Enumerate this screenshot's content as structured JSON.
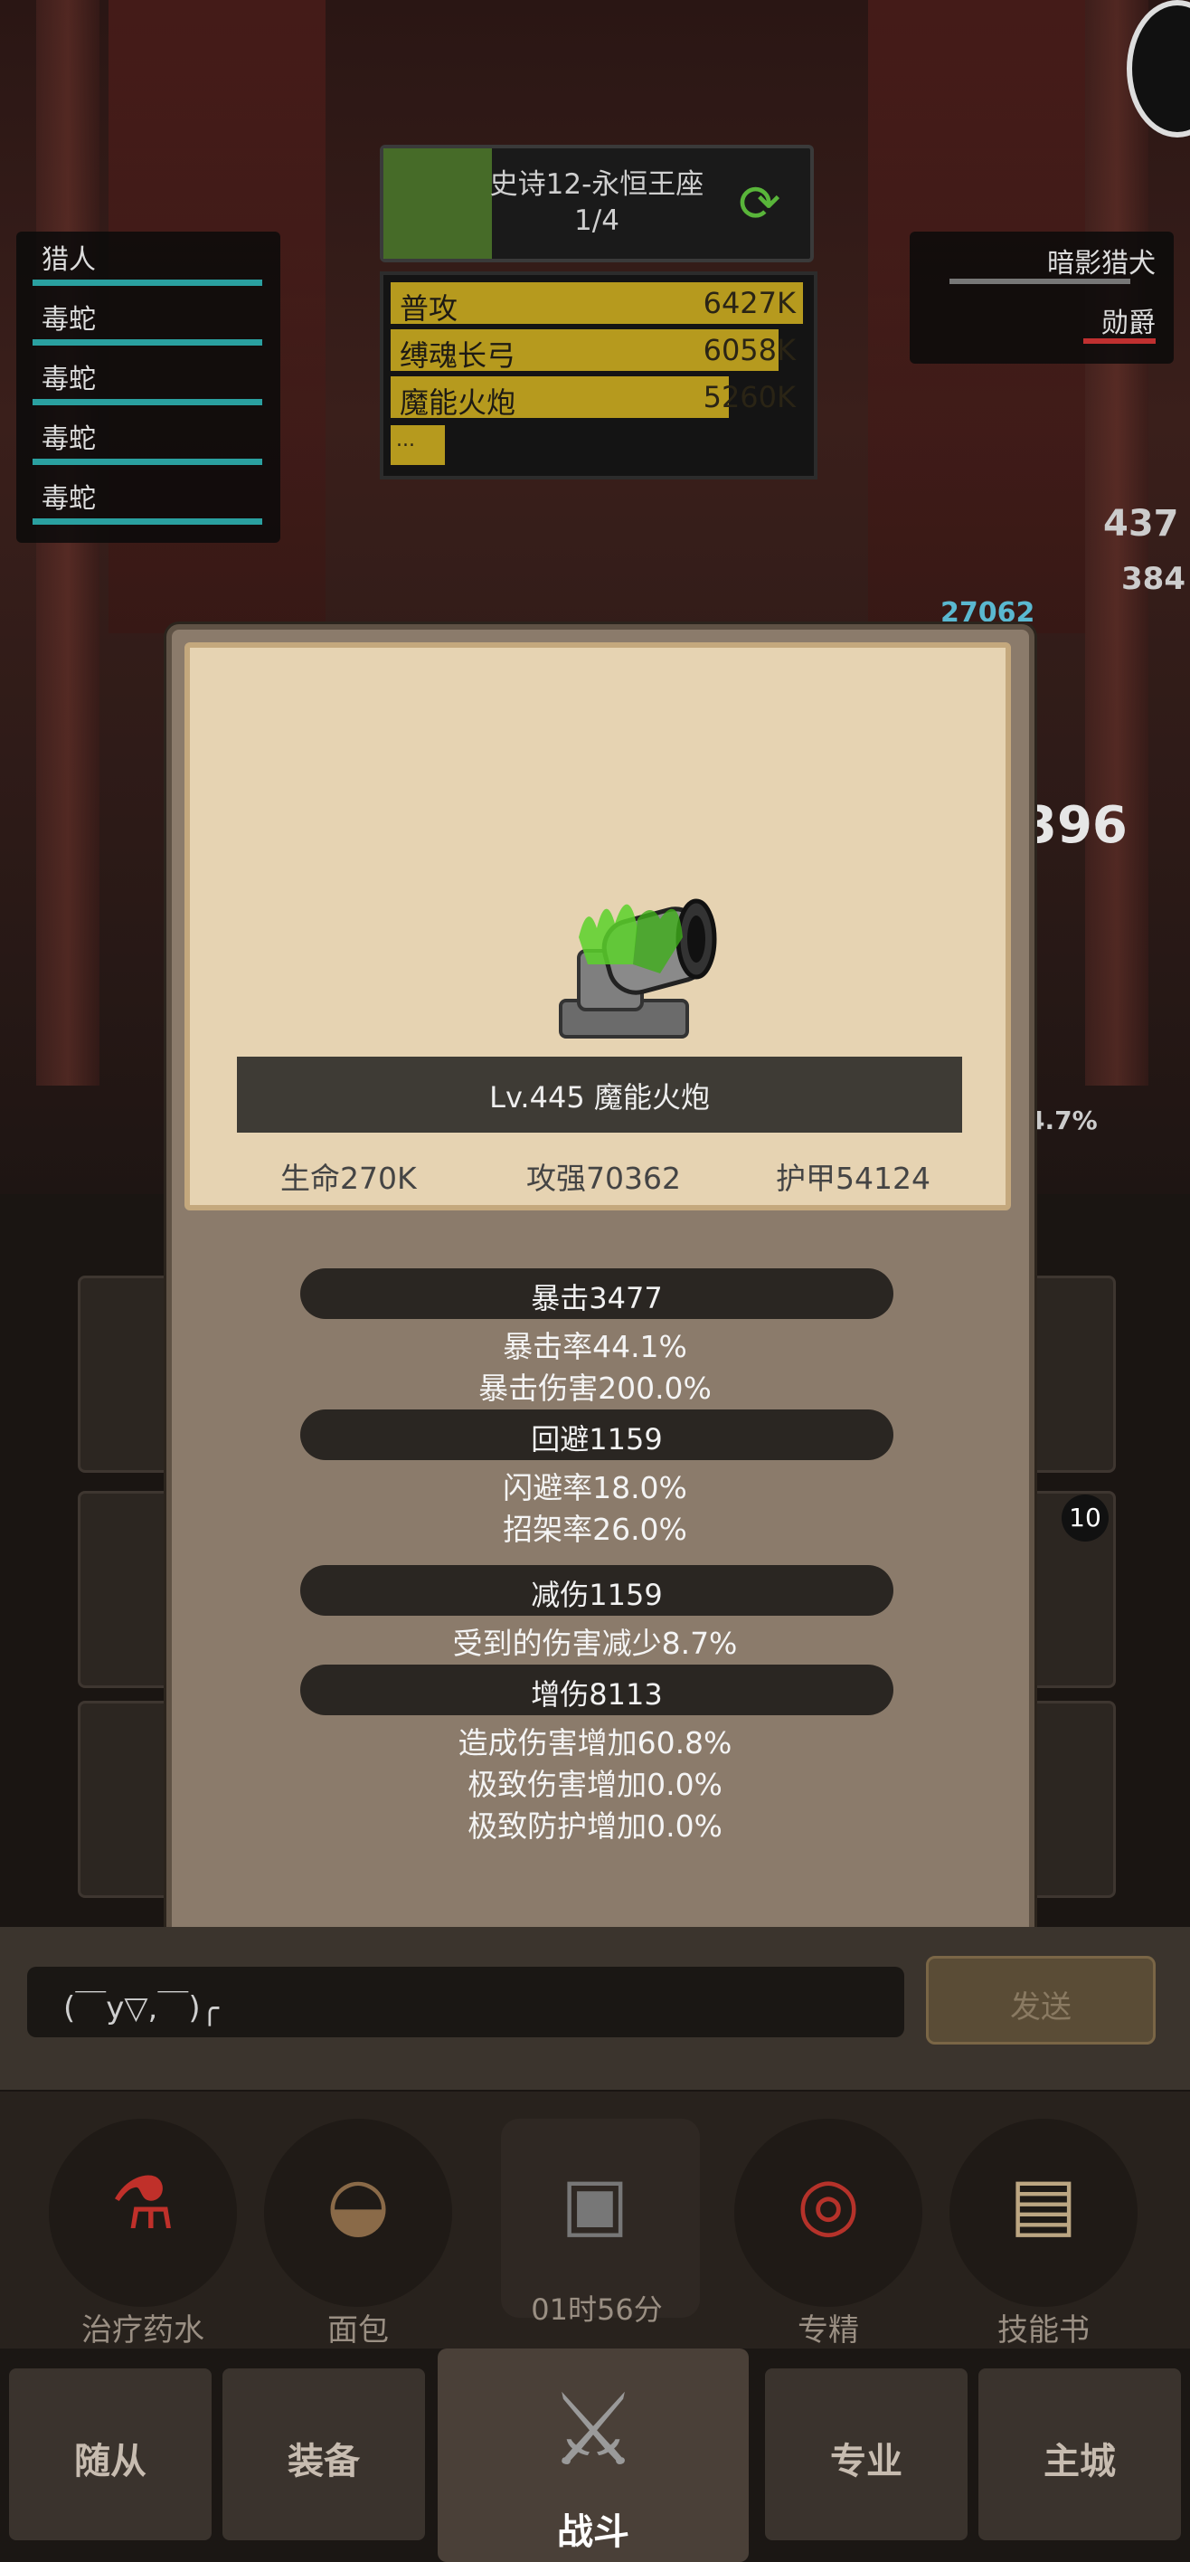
{
  "boss": {
    "name": "史诗12-永恒王座",
    "progress": "1/4"
  },
  "damage_list": [
    {
      "name": "普攻",
      "value": "6427K",
      "fraction": 1.0
    },
    {
      "name": "缚魂长弓",
      "value": "6058K",
      "fraction": 0.94
    },
    {
      "name": "魔能火炮",
      "value": "5260K",
      "fraction": 0.82
    }
  ],
  "damage_more": "...",
  "team_left": [
    "猎人",
    "毒蛇",
    "毒蛇",
    "毒蛇",
    "毒蛇"
  ],
  "team_right": [
    "暗影猎犬",
    "勋爵"
  ],
  "item": {
    "title": "Lv.445 魔能火炮",
    "hp": "生命270K",
    "atk": "攻强70362",
    "armor": "护甲54124"
  },
  "stats": [
    {
      "header": "暴击3477",
      "lines": [
        "暴击率44.1%",
        "暴击伤害200.0%"
      ]
    },
    {
      "header": "回避1159",
      "lines": [
        "闪避率18.0%",
        "招架率26.0%"
      ]
    },
    {
      "header": "减伤1159",
      "lines": [
        "受到的伤害减少8.7%"
      ]
    },
    {
      "header": "增伤8113",
      "lines": [
        "造成伤害增加60.8%",
        "极致伤害增加0.0%",
        "极致防护增加0.0%"
      ]
    }
  ],
  "chat": {
    "text": "(￣y▽,￣)╭",
    "send": "发送"
  },
  "tools": [
    {
      "label": "治疗药水",
      "icon": "potion-icon"
    },
    {
      "label": "面包",
      "icon": "bread-icon"
    },
    {
      "label": "专精",
      "icon": "mastery-icon"
    },
    {
      "label": "技能书",
      "icon": "skillbook-icon"
    }
  ],
  "timer": "01时56分",
  "nav": {
    "companions": "随从",
    "equipment": "装备",
    "battle": "战斗",
    "profession": "专业",
    "city": "主城"
  },
  "badge_count": "10",
  "side_percent": "4.7%"
}
